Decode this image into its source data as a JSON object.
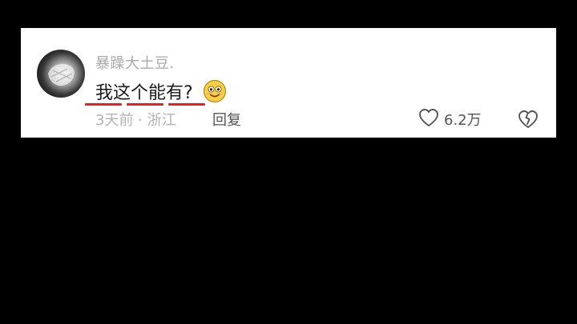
{
  "comment": {
    "username": "暴躁大土豆.",
    "text": "我这个能有?",
    "emoji": "smiling-face-emoji",
    "time": "3天前",
    "separator": "·",
    "location": "浙江",
    "meta_text": "3天前 · 浙江",
    "reply_label": "回复",
    "like_count": "6.2万",
    "like_icon": "heart-outline-icon",
    "dislike_icon": "broken-heart-icon"
  },
  "colors": {
    "background": "#000000",
    "card": "#ffffff",
    "underline": "#d8242a",
    "username": "#a9a9a9",
    "text": "#1b1b1b",
    "meta": "#b3b3b3",
    "action": "#555555"
  }
}
